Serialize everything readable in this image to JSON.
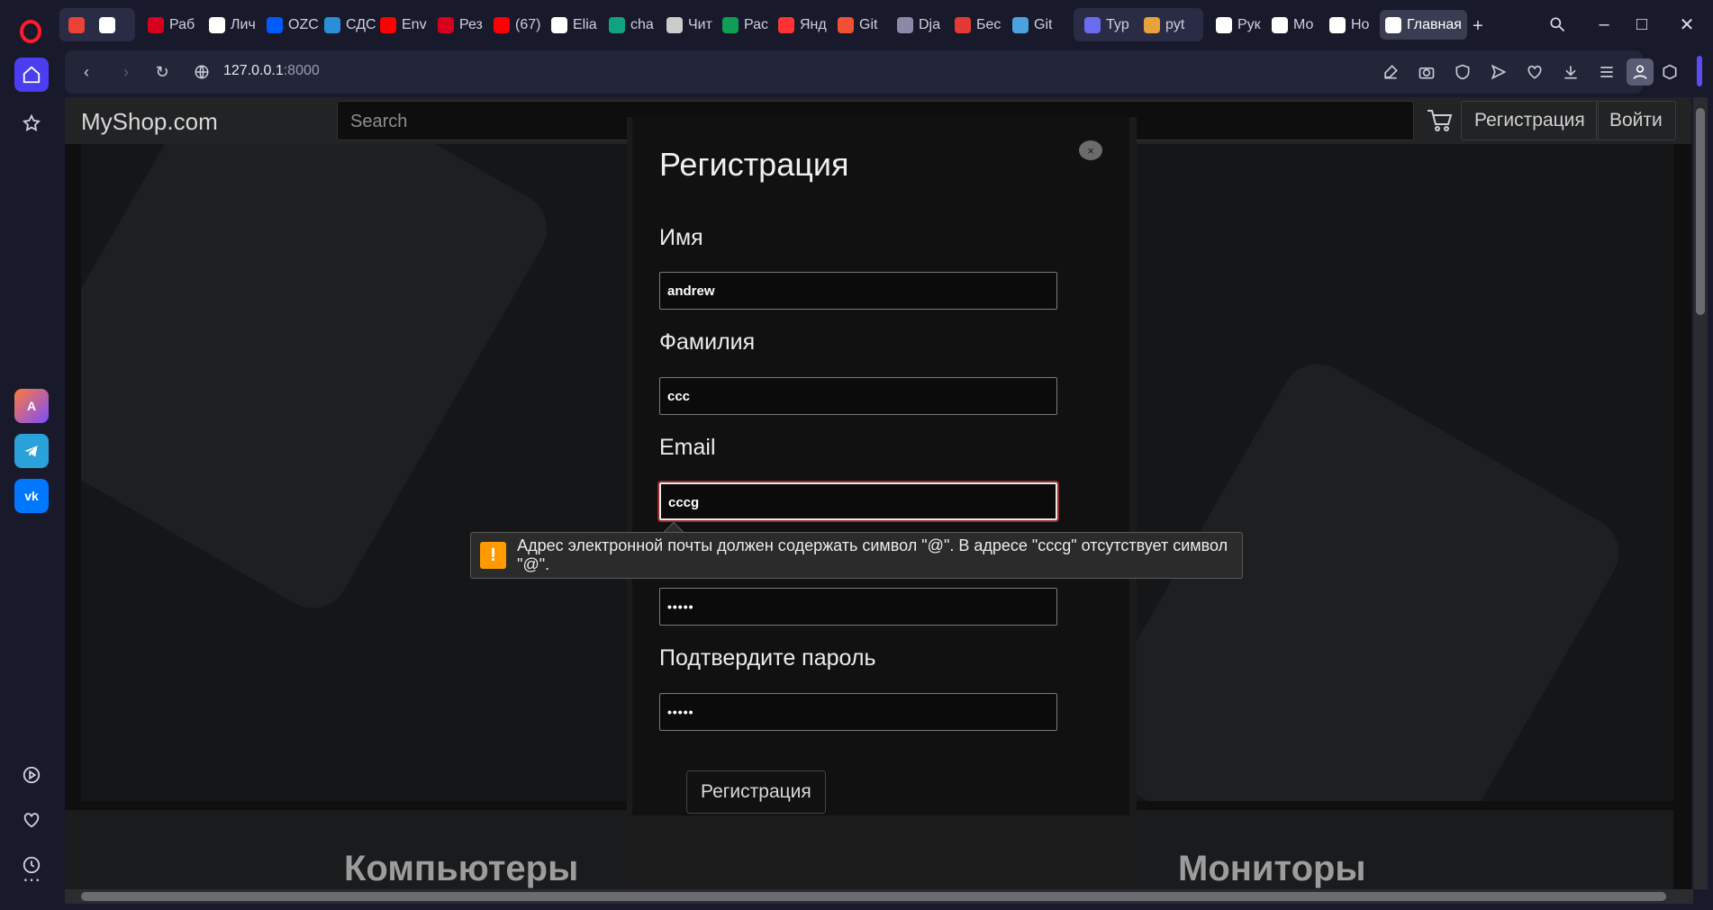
{
  "browser": {
    "tabs": [
      {
        "label": "",
        "icon": "gmail-icon",
        "color": "#ea4335"
      },
      {
        "label": "",
        "icon": "app-icon",
        "color": "#ffffff"
      },
      {
        "label": "Раб",
        "icon": "hh-icon",
        "color": "#d6001c"
      },
      {
        "label": "Лич",
        "icon": "circle-icon",
        "color": "#ffffff"
      },
      {
        "label": "OZC",
        "icon": "ozon-icon",
        "color": "#005bff"
      },
      {
        "label": "СДС",
        "icon": "t-icon",
        "color": "#2a8fd8"
      },
      {
        "label": "Env",
        "icon": "youtube-icon",
        "color": "#ff0000"
      },
      {
        "label": "Рез",
        "icon": "hh-icon",
        "color": "#d6001c"
      },
      {
        "label": "(67)",
        "icon": "youtube-icon",
        "color": "#ff0000"
      },
      {
        "label": "Elia",
        "icon": "github-icon",
        "color": "#ffffff"
      },
      {
        "label": "cha",
        "icon": "openai-icon",
        "color": "#10a37f"
      },
      {
        "label": "Чит",
        "icon": "book-icon",
        "color": "#cccccc"
      },
      {
        "label": "Рас",
        "icon": "plus-doc-icon",
        "color": "#0f9d58"
      },
      {
        "label": "Янд",
        "icon": "map-pin-icon",
        "color": "#ff3333"
      },
      {
        "label": "Git",
        "icon": "git-icon",
        "color": "#f05033"
      },
      {
        "label": "Dja",
        "icon": "mail-icon",
        "color": "#8a8aa8"
      },
      {
        "label": "Бес",
        "icon": "square-icon",
        "color": "#e53935"
      },
      {
        "label": "Git",
        "icon": "cloud-icon",
        "color": "#4aa3df"
      },
      {
        "label": "Typ",
        "icon": "people-icon",
        "color": "#6a6cf0"
      },
      {
        "label": "pyt",
        "icon": "python-icon",
        "color": "#e8a23a"
      },
      {
        "label": "Рук",
        "icon": "m-icon",
        "color": "#ffffff"
      },
      {
        "label": "Мо",
        "icon": "github-icon",
        "color": "#ffffff"
      },
      {
        "label": "Ho",
        "icon": "notion-icon",
        "color": "#ffffff"
      },
      {
        "label": "Главная",
        "icon": "globe-icon",
        "color": "#ffffff"
      }
    ],
    "url_main": "127.0.0.1",
    "url_port": ":8000"
  },
  "site": {
    "brand": "MyShop.com",
    "search_placeholder": "Search",
    "register_label": "Регистрация",
    "login_label": "Войти",
    "sections": [
      "Компьютеры",
      "Мониторы"
    ]
  },
  "modal": {
    "title": "Регистрация",
    "close_symbol": "×",
    "first_name_label": "Имя",
    "first_name_value": "andrew",
    "last_name_label": "Фамилия",
    "last_name_value": "ccc",
    "email_label": "Email",
    "email_value": "cccg",
    "password_value": "•••••",
    "confirm_label": "Подтвердите пароль",
    "confirm_value": "•••••",
    "submit_label": "Регистрация"
  },
  "validation": {
    "icon": "!",
    "message": "Адрес электронной почты должен содержать символ \"@\". В адресе \"cccg\" отсутствует символ \"@\"."
  }
}
